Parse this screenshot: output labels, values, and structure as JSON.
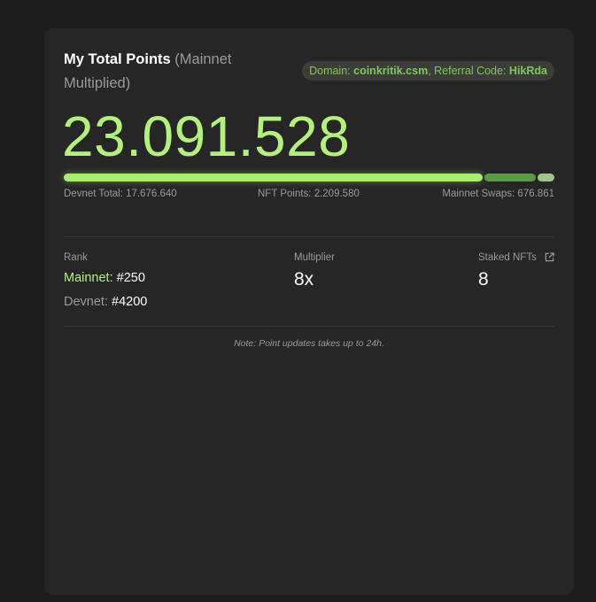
{
  "header": {
    "title": "My Total Points",
    "subtitle": "(Mainnet Multiplied)",
    "domain_label": "Domain:",
    "domain_value": "coinkritik.csm",
    "referral_label": ", Referral Code:",
    "referral_value": "HikRda"
  },
  "total_points": "23.091.528",
  "progress": {
    "segments": [
      {
        "name": "devnet",
        "fraction": 0.86,
        "color": "#a9ec74"
      },
      {
        "name": "nft",
        "fraction": 0.106,
        "color": "#5a9a44"
      },
      {
        "name": "swaps",
        "fraction": 0.034,
        "color": "#9fc58a"
      }
    ],
    "devnet_label": "Devnet Total: 17.676.640",
    "nft_label": "NFT Points: 2.209.580",
    "swaps_label": "Mainnet Swaps: 676.861"
  },
  "stats": {
    "rank_label": "Rank",
    "mainnet_key": "Mainnet:",
    "mainnet_rank": "#250",
    "devnet_key": "Devnet:",
    "devnet_rank": "#4200",
    "multiplier_label": "Multiplier",
    "multiplier_value": "8x",
    "staked_label": "Staked NFTs",
    "staked_value": "8"
  },
  "note": "Note: Point updates takes up to 24h.",
  "icons": {
    "staked_link": "external-link-icon"
  },
  "colors": {
    "accent": "#b4f07e",
    "accent_dark": "#7fc75e",
    "card_bg": "#262626",
    "page_bg": "#1c1c1c"
  }
}
